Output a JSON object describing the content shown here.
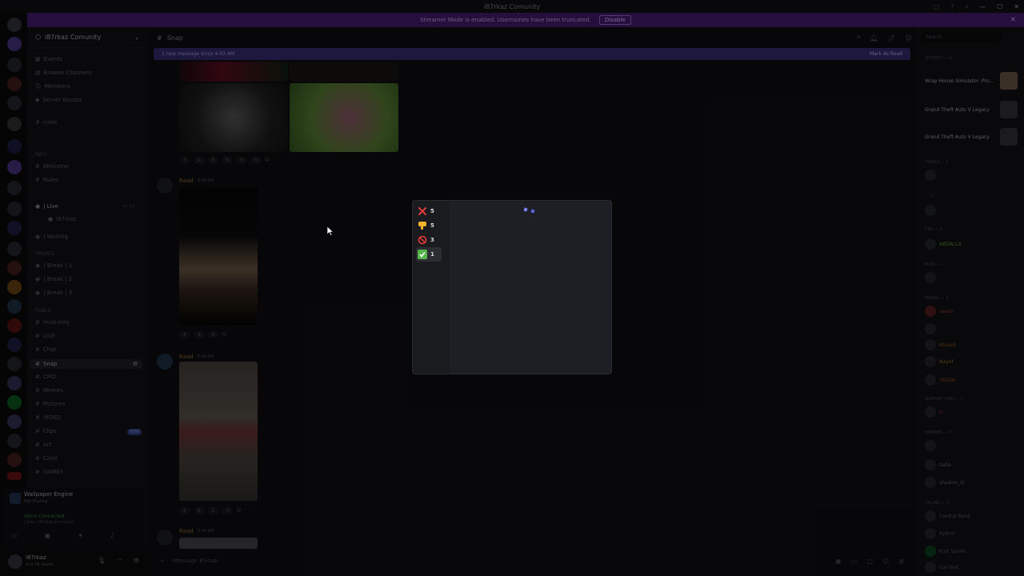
{
  "window": {
    "title": "i87rkaz Comunity"
  },
  "banner": {
    "text": "Streamer Mode is enabled. Usernames have been truncated.",
    "disable_label": "Disable"
  },
  "server": {
    "name": "i87rkaz Comunity"
  },
  "channel_list": {
    "items": [
      {
        "label": "Events",
        "icon": "calendar-icon"
      },
      {
        "label": "Browse Channels",
        "icon": "browse-icon"
      },
      {
        "label": "Members",
        "icon": "members-icon"
      },
      {
        "label": "Server Boosts",
        "icon": "boost-icon"
      },
      {
        "label": "rules",
        "icon": "hash-icon"
      },
      {
        "label": "Welcome",
        "icon": "hash-icon"
      },
      {
        "label": "Rules",
        "icon": "hash-icon"
      },
      {
        "label": "| Live",
        "icon": "voice-icon"
      },
      {
        "label": "i87rkaz",
        "icon": "user-icon"
      },
      {
        "label": "| Waiting",
        "icon": "voice-icon"
      },
      {
        "label": "| Break | 1",
        "icon": "voice-icon"
      },
      {
        "label": "| Break | 2",
        "icon": "voice-icon"
      },
      {
        "label": "| Break | 3",
        "icon": "voice-icon"
      },
      {
        "label": "mod-only",
        "icon": "hash-icon"
      },
      {
        "label": "LIVE",
        "icon": "hash-icon"
      },
      {
        "label": "Chat",
        "icon": "hash-icon"
      },
      {
        "label": "Snap",
        "icon": "hash-icon"
      },
      {
        "label": "CMD",
        "icon": "hash-icon"
      },
      {
        "label": "Memes",
        "icon": "hash-icon"
      },
      {
        "label": "Pictures",
        "icon": "hash-icon"
      },
      {
        "label": "VIDEO",
        "icon": "hash-icon"
      },
      {
        "label": "Clips",
        "icon": "hash-icon"
      },
      {
        "label": "Art",
        "icon": "hash-icon"
      },
      {
        "label": "Color",
        "icon": "hash-icon"
      },
      {
        "label": "GAMES",
        "icon": "hash-icon"
      }
    ],
    "categories": [
      "Info",
      "Private",
      "Public"
    ],
    "new_badge": "NEW",
    "live_count": "4 / 12"
  },
  "activity": {
    "title": "Wallpaper Engine",
    "subtitle": "Not Sharing",
    "voice_status": "Voice Connected",
    "voice_channel": "| Live / i87rkaz Comunity"
  },
  "user": {
    "name": "i87rkaz",
    "status": "In a VR Game"
  },
  "main": {
    "channel_name": "Snap",
    "new_messages": "1 new message since 4:03 AM",
    "mark_read": "Mark As Read",
    "messages": [
      {
        "author": "Raad",
        "time": "9:46 AM",
        "reactions": [
          "7",
          "4",
          "5",
          "5",
          "5",
          "5"
        ]
      },
      {
        "author": "Raad",
        "time": "9:46 AM",
        "reactions": [
          "4",
          "4",
          "5"
        ]
      },
      {
        "author": "Raad",
        "time": "9:46 AM",
        "reactions": [
          "5",
          "5",
          "1",
          "3"
        ]
      },
      {
        "author": "Raad",
        "time": "9:46 AM"
      }
    ],
    "composer_placeholder": "Message #Snap"
  },
  "members": {
    "search_placeholder": "Search",
    "groups": [
      "Activity — 4",
      "i7rkaz — 1",
      "— 1",
      "CEO — 1",
      "Mod — 1",
      "Friend — 5",
      "Support CMD — 1",
      "Member — 3",
      "Online — 5"
    ],
    "games": [
      "Wrap House Simulator: Pro...",
      "Grand Theft Auto V Legacy",
      "Grand Theft Auto V Legacy"
    ],
    "names": [
      "ABDALLA",
      "Leash",
      "Khaled",
      "Nayef",
      "YAZAN",
      "Jz",
      "Saba",
      "shadow_i2",
      "Central Bank",
      "Rythm",
      "Kick Sports",
      "Carl-bot"
    ]
  },
  "popup": {
    "reactions": [
      {
        "icon": "cross-mark-icon",
        "count": "5"
      },
      {
        "icon": "thumbs-down-icon",
        "count": "5"
      },
      {
        "icon": "prohibited-icon",
        "count": "3"
      },
      {
        "icon": "check-mark-icon",
        "count": "1"
      }
    ]
  }
}
